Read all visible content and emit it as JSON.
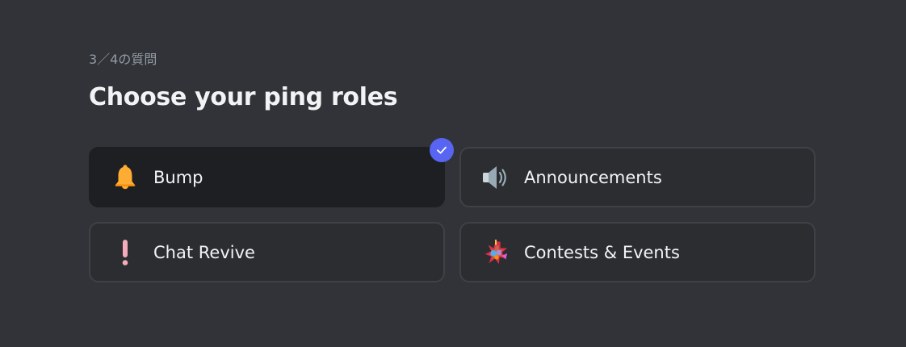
{
  "question": {
    "step_text": "3／4の質問",
    "title": "Choose your ping roles"
  },
  "options": [
    {
      "label": "Bump",
      "icon": "bell-icon",
      "selected": true
    },
    {
      "label": "Announcements",
      "icon": "speaker-icon",
      "selected": false
    },
    {
      "label": "Chat Revive",
      "icon": "exclamation-icon",
      "selected": false
    },
    {
      "label": "Contests & Events",
      "icon": "pinata-icon",
      "selected": false
    }
  ],
  "colors": {
    "background": "#313338",
    "card": "#2b2d31",
    "card_selected": "#1e1f22",
    "accent": "#5865f2",
    "muted_text": "#949ba4"
  }
}
